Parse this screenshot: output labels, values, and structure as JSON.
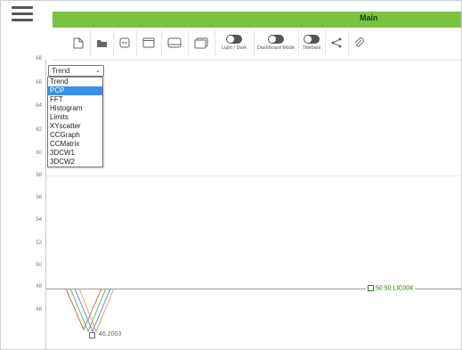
{
  "window": {
    "title": "Main"
  },
  "toolbar": {
    "light_dark_label": "Light / Dark",
    "dashboard_mode_label": "Dashboard Mode",
    "titlebars_label": "Titlebars"
  },
  "chart": {
    "y_ticks": [
      "68",
      "66",
      "64",
      "62",
      "60",
      "58",
      "56",
      "54",
      "52",
      "50",
      "48",
      "46"
    ],
    "point_label": "50 50 LIC004",
    "min_label": "46.2003"
  },
  "dropdown": {
    "selected": "Trend",
    "options": [
      "Trend",
      "PCP",
      "FFT",
      "Histogram",
      "Limits",
      "XYscatter",
      "CCGraph",
      "CCMatrix",
      "3DCW1",
      "3DCW2"
    ],
    "highlighted": "PCP"
  },
  "colors": {
    "accent": "#7cc242",
    "selection": "#3d8ee9"
  }
}
